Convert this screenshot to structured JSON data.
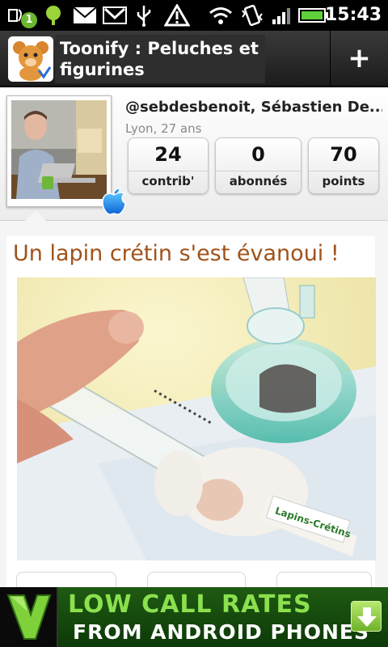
{
  "status_bar": {
    "time": "15:43",
    "notification_count": "1",
    "icons": [
      "usb-debug-icon",
      "notification-badge-icon",
      "green-dot-icon",
      "mail-icon",
      "gmail-icon",
      "usb-icon",
      "warning-icon",
      "wifi-icon",
      "vibrate-icon",
      "signal-icon",
      "battery-icon"
    ]
  },
  "app_bar": {
    "title": "Toonify : Peluches et figurines",
    "add_label": "+"
  },
  "profile": {
    "username": "@sebdesbenoit, Sébastien De...",
    "location": "Lyon, 27 ans",
    "stats": [
      {
        "value": "24",
        "label": "contrib'"
      },
      {
        "value": "0",
        "label": "abonnés"
      },
      {
        "value": "70",
        "label": "points"
      }
    ]
  },
  "post": {
    "title": "Un lapin crétin s'est évanoui !",
    "toy_tag": "Lapins-Crétins"
  },
  "ad": {
    "line1": "LOW CALL RATES",
    "line2": "FROM ANDROID PHONES"
  },
  "colors": {
    "title_accent": "#a0521a",
    "ad_green": "#8be04e",
    "status_green": "#6ab82f"
  }
}
